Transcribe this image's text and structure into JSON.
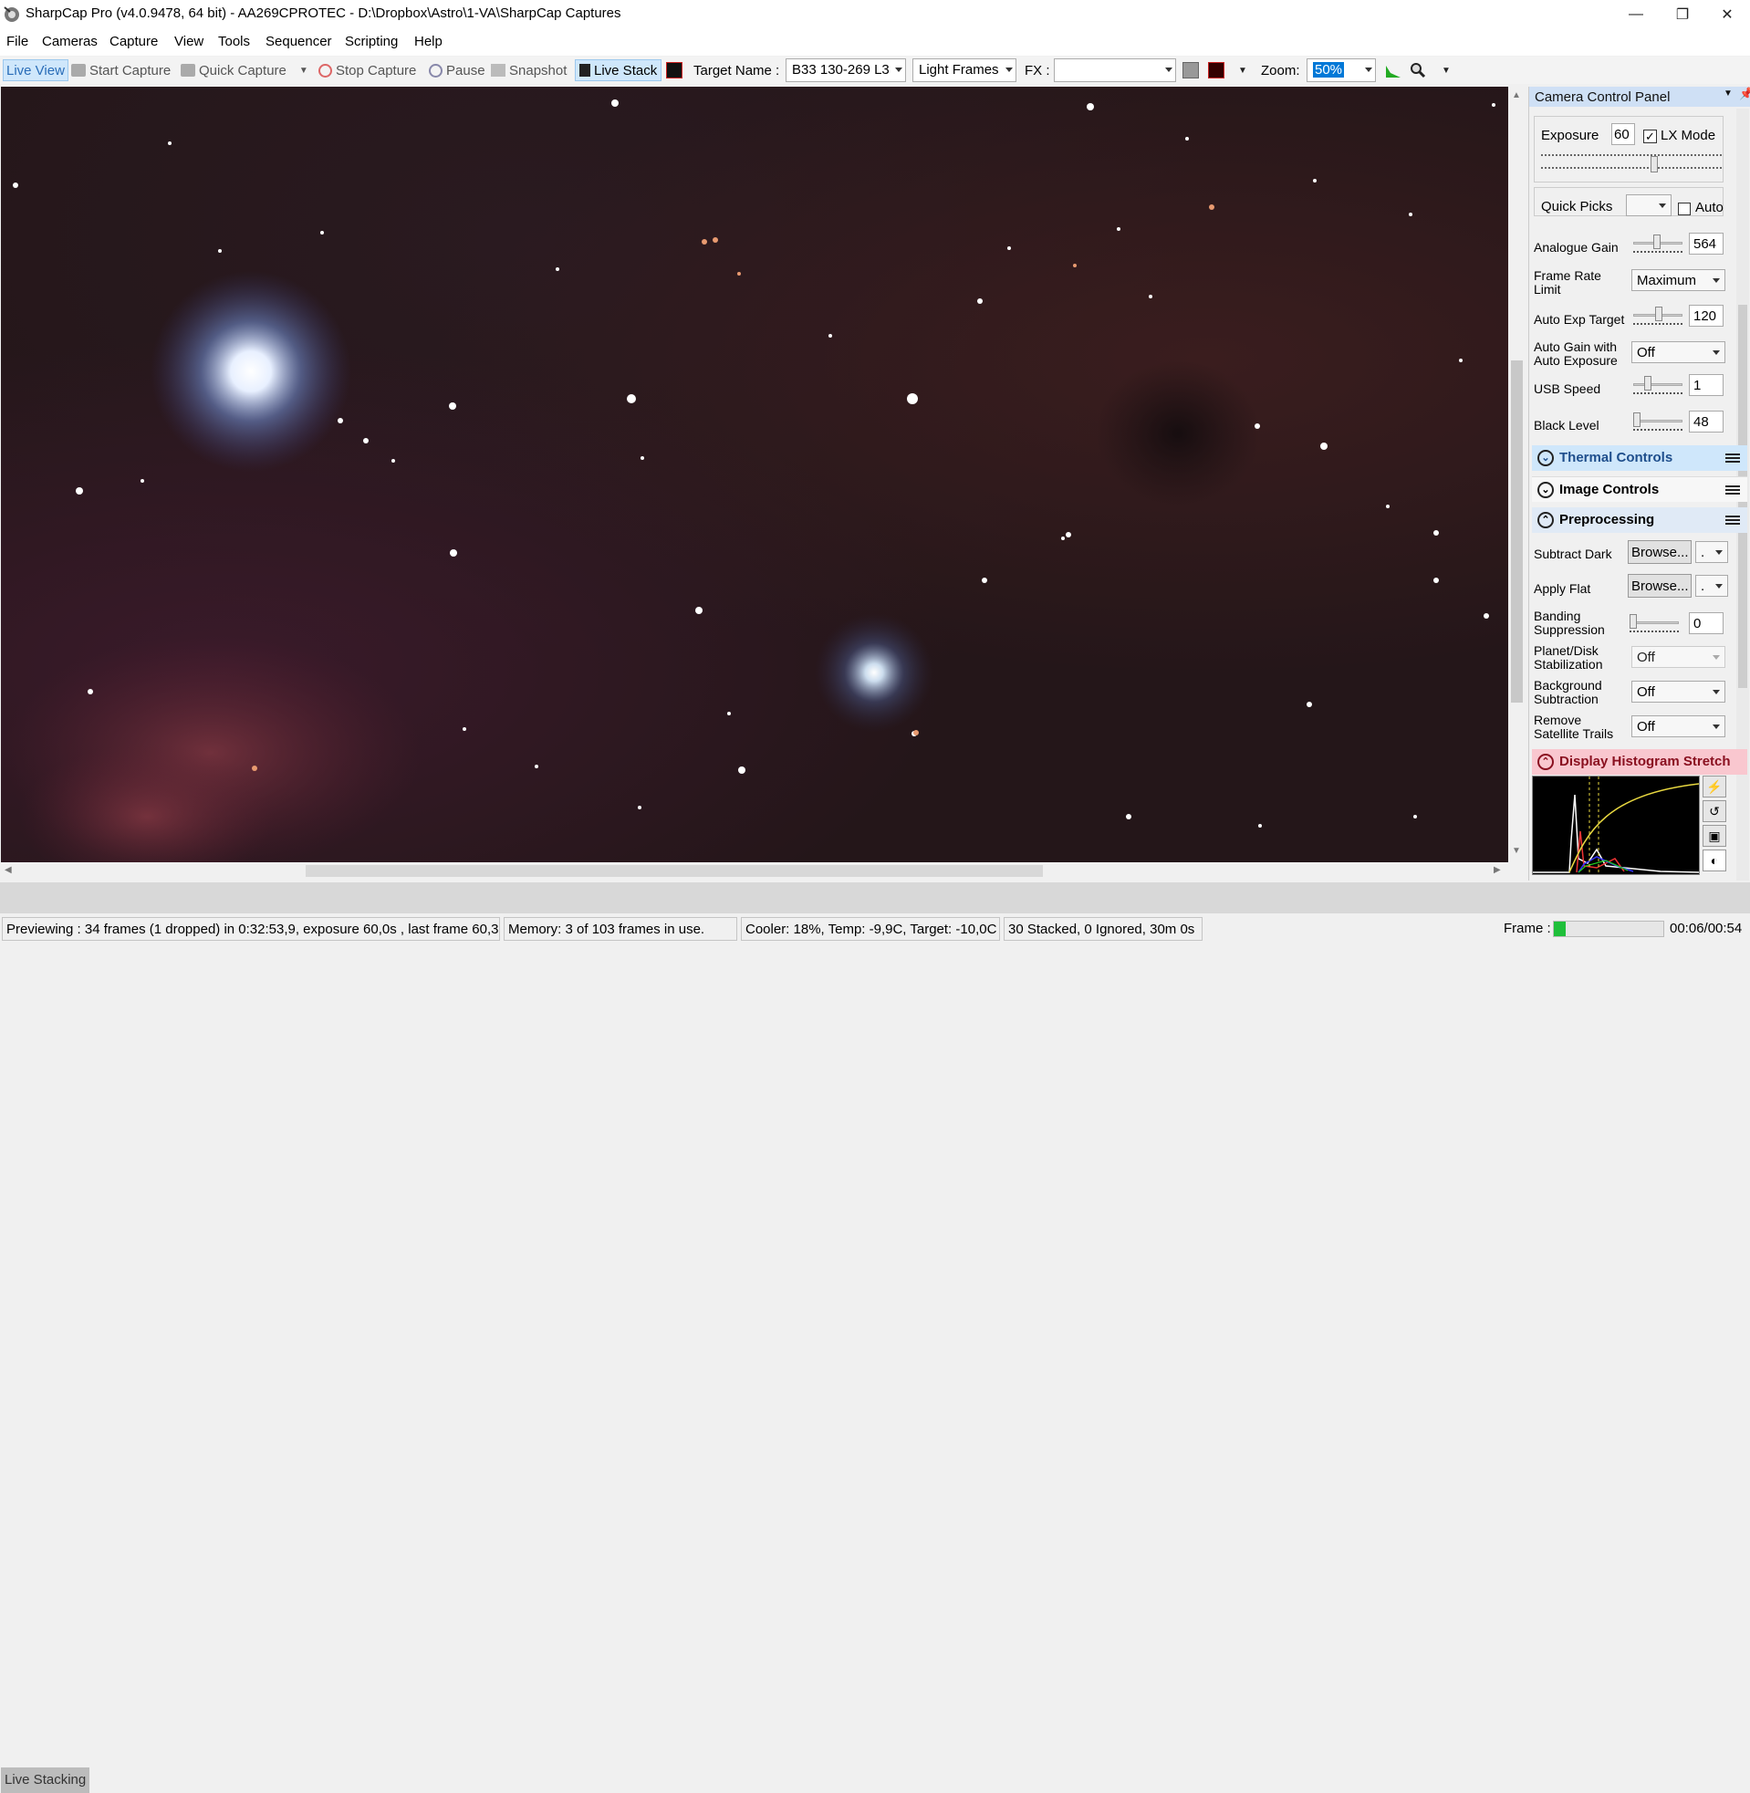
{
  "window": {
    "title": "SharpCap Pro (v4.0.9478, 64 bit) - AA269CPROTEC - D:\\Dropbox\\Astro\\1-VA\\SharpCap Captures"
  },
  "menu": [
    "File",
    "Cameras",
    "Capture",
    "View",
    "Tools",
    "Sequencer",
    "Scripting",
    "Help"
  ],
  "toolbar": {
    "live_view": "Live View",
    "start_capture": "Start Capture",
    "quick_capture": "Quick Capture",
    "stop_capture": "Stop Capture",
    "pause": "Pause",
    "snapshot": "Snapshot",
    "live_stack": "Live Stack",
    "target_name_label": "Target Name :",
    "target_name_value": "B33 130-269 L3",
    "frame_type": "Light Frames",
    "fx_label": "FX :",
    "fx_value": "",
    "zoom_label": "Zoom:",
    "zoom_value": "50%"
  },
  "panel": {
    "title": "Camera Control Panel",
    "exposure_label": "Exposure",
    "exposure_value": "60",
    "lx_mode_label": "LX Mode",
    "lx_mode_checked": true,
    "quick_picks_label": "Quick Picks",
    "auto_label": "Auto",
    "analogue_gain_label": "Analogue Gain",
    "analogue_gain_value": "564",
    "frame_rate_label": "Frame Rate Limit",
    "frame_rate_value": "Maximum",
    "auto_exp_target_label": "Auto Exp Target",
    "auto_exp_target_value": "120",
    "auto_gain_label": "Auto Gain with Auto Exposure",
    "auto_gain_value": "Off",
    "usb_speed_label": "USB Speed",
    "usb_speed_value": "1",
    "black_level_label": "Black Level",
    "black_level_value": "48",
    "thermal_controls": "Thermal Controls",
    "image_controls": "Image Controls",
    "preprocessing": "Preprocessing",
    "subtract_dark_label": "Subtract Dark",
    "apply_flat_label": "Apply Flat",
    "browse_label": "Browse...",
    "small_dropdown": ".",
    "banding_label": "Banding Suppression",
    "banding_value": "0",
    "planet_label": "Planet/Disk Stabilization",
    "planet_value": "Off",
    "bg_sub_label": "Background Subtraction",
    "bg_sub_value": "Off",
    "satellite_label": "Remove Satellite Trails",
    "satellite_value": "Off",
    "histogram_stretch": "Display Histogram Stretch"
  },
  "bottom_tab": "Live Stacking",
  "status": {
    "preview": "Previewing : 34 frames (1 dropped) in 0:32:53,9, exposure 60,0s , last frame 60,3s",
    "memory": "Memory: 3 of 103 frames in use.",
    "cooler": "Cooler: 18%, Temp: -9,9C, Target: -10,0C",
    "stacked": "30 Stacked, 0 Ignored, 30m 0s",
    "frame_label": "Frame :",
    "frame_time": "00:06/00:54"
  },
  "colors": {
    "accent_blue": "#cfe0f5",
    "section_highlight": "#cfe7fb",
    "histogram_highlight": "#f9c7cf",
    "progress_green": "#1fbf3a"
  },
  "frame_progress": 0.11
}
